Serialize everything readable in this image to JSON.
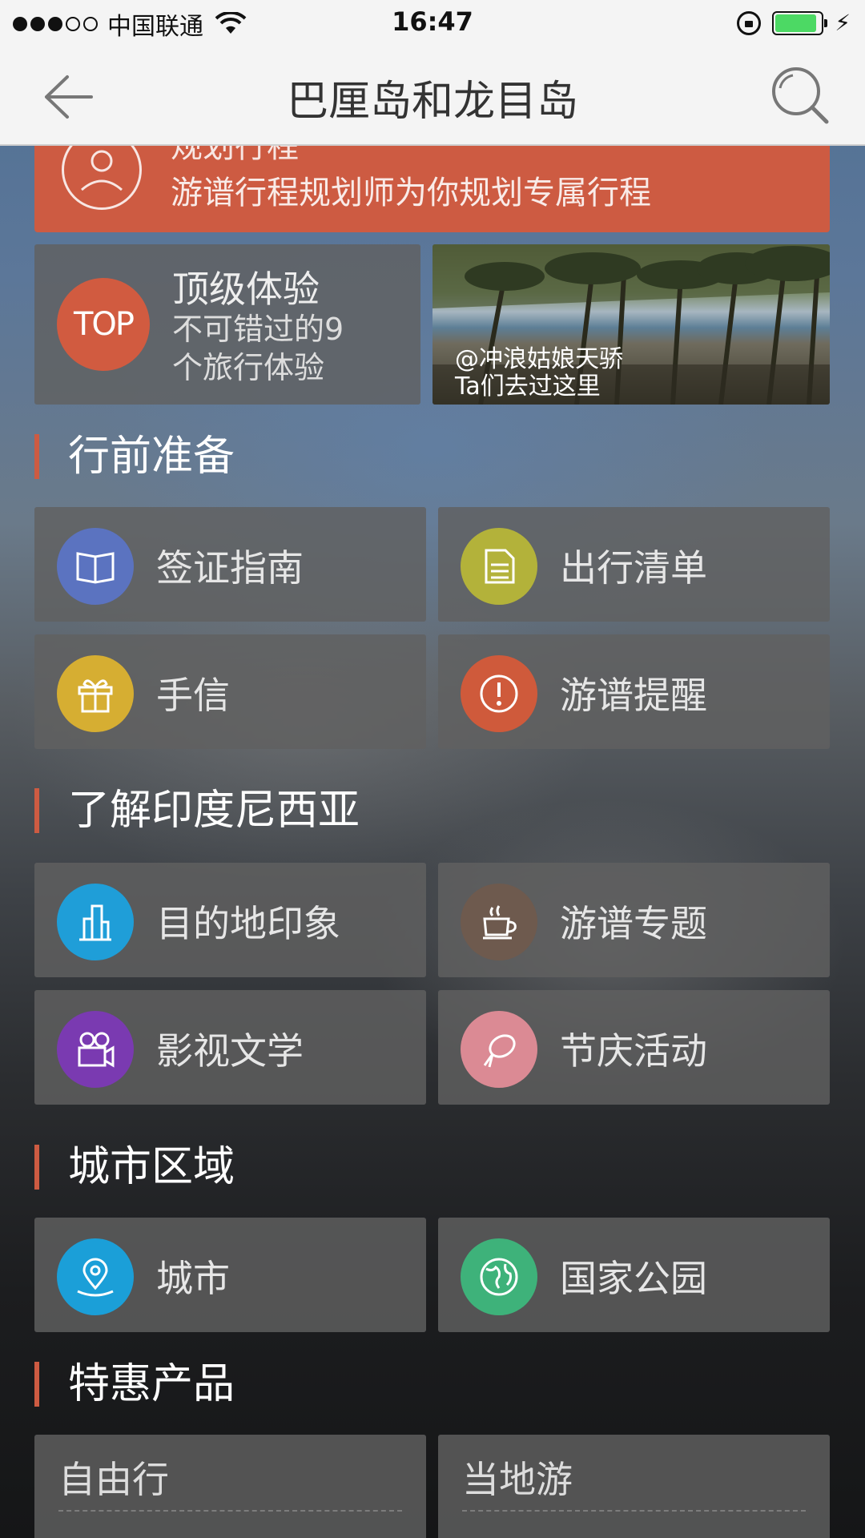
{
  "status_bar": {
    "carrier": "中国联通",
    "time": "16:47",
    "battery_level": 0.9
  },
  "nav": {
    "title": "巴厘岛和龙目岛",
    "back_icon": "back-arrow-icon",
    "search_icon": "search-icon"
  },
  "plan_banner": {
    "title": "规划行程",
    "subtitle": "游谱行程规划师为你规划专属行程",
    "icon": "planner-person-icon"
  },
  "top_experience": {
    "icon_text": "TOP",
    "title": "顶级体验",
    "subtitle": "不可错过的9个旅行体验"
  },
  "photo_card": {
    "caption_user": "@冲浪姑娘天骄",
    "caption_text": "Ta们去过这里"
  },
  "sections": [
    {
      "title": "行前准备",
      "items": [
        {
          "label": "签证指南",
          "icon": "book-icon",
          "color": "#5b73c0"
        },
        {
          "label": "出行清单",
          "icon": "document-icon",
          "color": "#b3b23a"
        },
        {
          "label": "手信",
          "icon": "gift-icon",
          "color": "#d6ae32"
        },
        {
          "label": "游谱提醒",
          "icon": "alert-icon",
          "color": "#cf5a3b"
        }
      ]
    },
    {
      "title": "了解印度尼西亚",
      "items": [
        {
          "label": "目的地印象",
          "icon": "buildings-icon",
          "color": "#1f9ed8"
        },
        {
          "label": "游谱专题",
          "icon": "coffee-cup-icon",
          "color": "#6e5a4e"
        },
        {
          "label": "影视文学",
          "icon": "film-camera-icon",
          "color": "#7a3ab1"
        },
        {
          "label": "节庆活动",
          "icon": "lantern-icon",
          "color": "#db8a94"
        }
      ]
    },
    {
      "title": "城市区域",
      "items": [
        {
          "label": "城市",
          "icon": "map-pin-icon",
          "color": "#1b9fd8"
        },
        {
          "label": "国家公园",
          "icon": "globe-icon",
          "color": "#3eb27a"
        }
      ]
    },
    {
      "title": "特惠产品",
      "items": [
        {
          "label": "自由行"
        },
        {
          "label": "当地游"
        }
      ]
    }
  ]
}
